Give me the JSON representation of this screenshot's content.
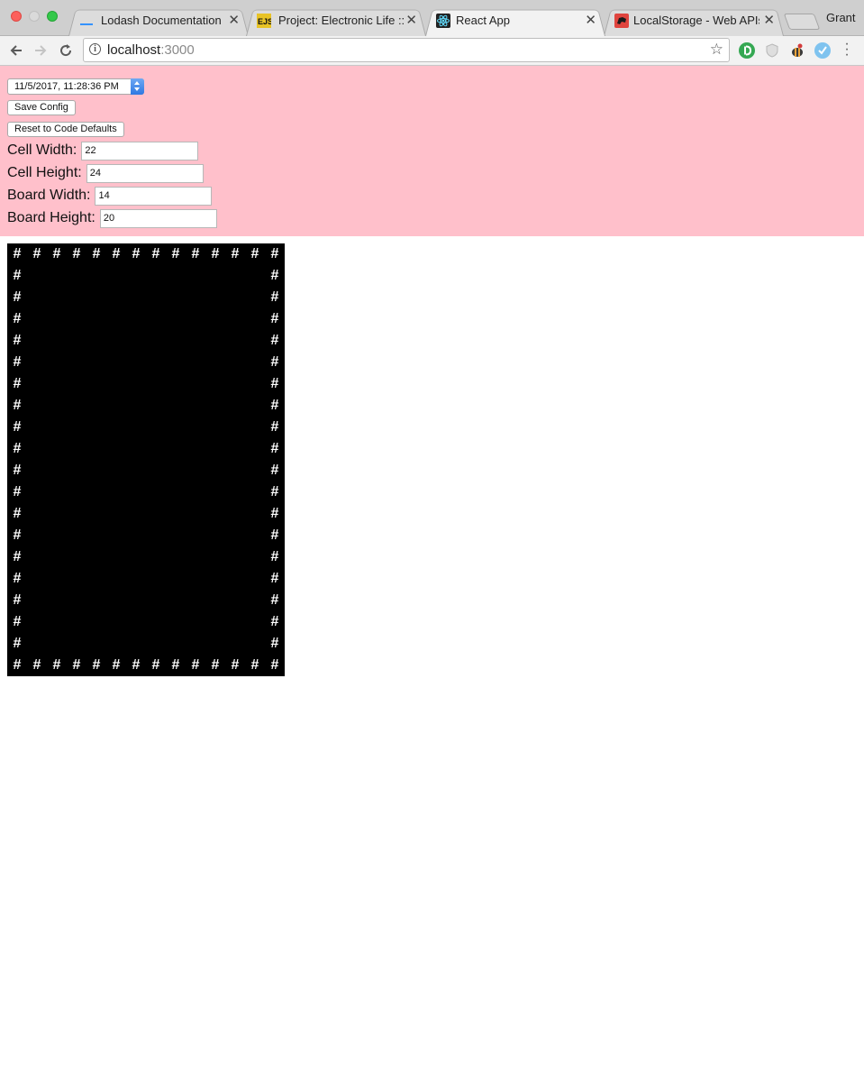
{
  "browser": {
    "tabs": [
      {
        "title": "Lodash Documentation",
        "icon": "lodash-icon",
        "active": false
      },
      {
        "title": "Project: Electronic Life ::",
        "icon": "ejs-icon",
        "active": false
      },
      {
        "title": "React App",
        "icon": "react-icon",
        "active": true
      },
      {
        "title": "LocalStorage - Web APIs",
        "icon": "mdn-icon",
        "active": false
      }
    ],
    "tab_close": "✕",
    "profile_name": "Grant",
    "url_host": "localhost",
    "url_port": ":3000"
  },
  "config": {
    "saved_config_value": "11/5/2017, 11:28:36 PM",
    "save_label": "Save Config",
    "reset_label": "Reset to Code Defaults",
    "fields": [
      {
        "label": "Cell Width:",
        "value": "22"
      },
      {
        "label": "Cell Height:",
        "value": "24"
      },
      {
        "label": "Board Width:",
        "value": "14"
      },
      {
        "label": "Board Height:",
        "value": "20"
      }
    ]
  },
  "board": {
    "columns": 14,
    "rows": 20,
    "wall_char": "#",
    "background": "#000000",
    "cell_color": "#ffffff"
  },
  "colors": {
    "config_background": "#ffc0cb"
  }
}
